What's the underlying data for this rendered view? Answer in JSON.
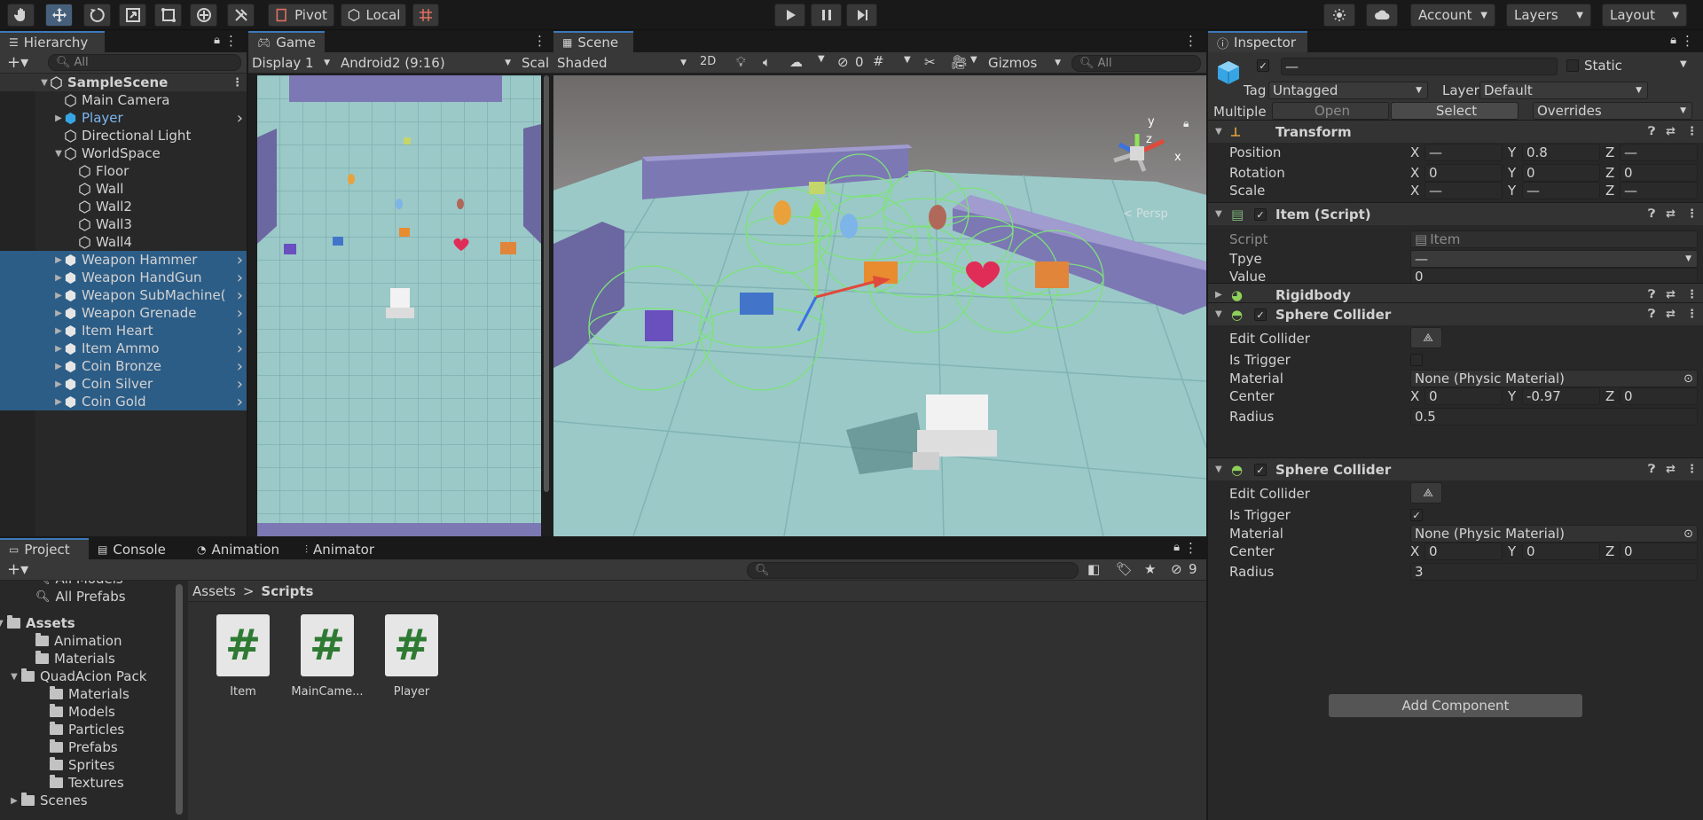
{
  "toolbar": {
    "pivot_label": "Pivot",
    "local_label": "Local",
    "account_label": "Account",
    "layers_label": "Layers",
    "layout_label": "Layout"
  },
  "hierarchy": {
    "tab_label": "Hierarchy",
    "search_placeholder": "All",
    "scene_name": "SampleScene",
    "items": [
      {
        "label": "Main Camera",
        "selected": false
      },
      {
        "label": "Player",
        "selected": false
      },
      {
        "label": "Directional Light",
        "selected": false
      },
      {
        "label": "WorldSpace",
        "selected": false
      },
      {
        "label": "Floor",
        "selected": false
      },
      {
        "label": "Wall",
        "selected": false
      },
      {
        "label": "Wall2",
        "selected": false
      },
      {
        "label": "Wall3",
        "selected": false
      },
      {
        "label": "Wall4",
        "selected": false
      },
      {
        "label": "Weapon Hammer",
        "selected": true
      },
      {
        "label": "Weapon HandGun",
        "selected": true
      },
      {
        "label": "Weapon SubMachine(",
        "selected": true
      },
      {
        "label": "Weapon Grenade",
        "selected": true
      },
      {
        "label": "Item Heart",
        "selected": true
      },
      {
        "label": "Item Ammo",
        "selected": true
      },
      {
        "label": "Coin Bronze",
        "selected": true
      },
      {
        "label": "Coin Silver",
        "selected": true
      },
      {
        "label": "Coin Gold",
        "selected": true
      }
    ]
  },
  "game": {
    "tab_label": "Game",
    "display_label": "Display 1",
    "resolution_label": "Android2 (9:16)",
    "scale_label": "Scal"
  },
  "scene": {
    "tab_label": "Scene",
    "shading_label": "Shaded",
    "mode_2d_label": "2D",
    "hidden_count": "0",
    "gizmos_label": "Gizmos",
    "search_placeholder": "All",
    "persp_label": "< Persp",
    "axis_y": "y",
    "axis_x": "x",
    "axis_z": "z"
  },
  "inspector": {
    "tab_label": "Inspector",
    "name_value": "—",
    "static_label": "Static",
    "tag_label": "Tag",
    "tag_value": "Untagged",
    "layer_label": "Layer",
    "layer_value": "Default",
    "multiple_label": "Multiple",
    "open_label": "Open",
    "select_label": "Select",
    "overrides_label": "Overrides",
    "transform": {
      "title": "Transform",
      "position_label": "Position",
      "position": {
        "x": "—",
        "y": "0.8",
        "z": "—"
      },
      "rotation_label": "Rotation",
      "rotation": {
        "x": "0",
        "y": "0",
        "z": "0"
      },
      "scale_label": "Scale",
      "scale": {
        "x": "—",
        "y": "—",
        "z": "—"
      }
    },
    "item_script": {
      "title": "Item (Script)",
      "script_label": "Script",
      "script_value": "Item",
      "tpye_label": "Tpye",
      "tpye_value": "—",
      "value_label": "Value",
      "value_value": "0"
    },
    "rigidbody_title": "Rigidbody",
    "collider1": {
      "title": "Sphere Collider",
      "edit_label": "Edit Collider",
      "trigger_label": "Is Trigger",
      "is_trigger": false,
      "material_label": "Material",
      "material_value": "None (Physic Material)",
      "center_label": "Center",
      "center": {
        "x": "0",
        "y": "-0.97",
        "z": "0"
      },
      "radius_label": "Radius",
      "radius_value": "0.5"
    },
    "collider2": {
      "title": "Sphere Collider",
      "edit_label": "Edit Collider",
      "trigger_label": "Is Trigger",
      "is_trigger": true,
      "material_label": "Material",
      "material_value": "None (Physic Material)",
      "center_label": "Center",
      "center": {
        "x": "0",
        "y": "0",
        "z": "0"
      },
      "radius_label": "Radius",
      "radius_value": "3"
    },
    "add_component_label": "Add Component",
    "axis_x": "X",
    "axis_y": "Y",
    "axis_z": "Z"
  },
  "bottom": {
    "tabs": [
      "Project",
      "Console",
      "Animation",
      "Animator"
    ],
    "hidden_count": "9",
    "breadcrumb_root": "Assets",
    "breadcrumb_sep": ">",
    "breadcrumb_current": "Scripts",
    "tree": [
      {
        "label": "All Models",
        "indent": 2,
        "type": "search"
      },
      {
        "label": "All Prefabs",
        "indent": 2,
        "type": "search"
      },
      {
        "label": "Assets",
        "indent": 0,
        "type": "folder",
        "bold": true
      },
      {
        "label": "Animation",
        "indent": 2,
        "type": "folder"
      },
      {
        "label": "Materials",
        "indent": 2,
        "type": "folder"
      },
      {
        "label": "QuadAcion Pack",
        "indent": 1,
        "type": "folder"
      },
      {
        "label": "Materials",
        "indent": 3,
        "type": "folder"
      },
      {
        "label": "Models",
        "indent": 3,
        "type": "folder"
      },
      {
        "label": "Particles",
        "indent": 3,
        "type": "folder"
      },
      {
        "label": "Prefabs",
        "indent": 3,
        "type": "folder"
      },
      {
        "label": "Sprites",
        "indent": 3,
        "type": "folder"
      },
      {
        "label": "Textures",
        "indent": 3,
        "type": "folder"
      },
      {
        "label": "Scenes",
        "indent": 1,
        "type": "folder"
      }
    ],
    "assets": [
      {
        "label": "Item",
        "glyph": "#"
      },
      {
        "label": "MainCame...",
        "glyph": "#"
      },
      {
        "label": "Player",
        "glyph": "#"
      }
    ]
  },
  "colors": {
    "accent": "#3a79bb",
    "selection": "#2c5d87",
    "scene_floor": "#9bc9c8",
    "wall": "#7c78b4",
    "gizmo_green": "#7de27a"
  }
}
